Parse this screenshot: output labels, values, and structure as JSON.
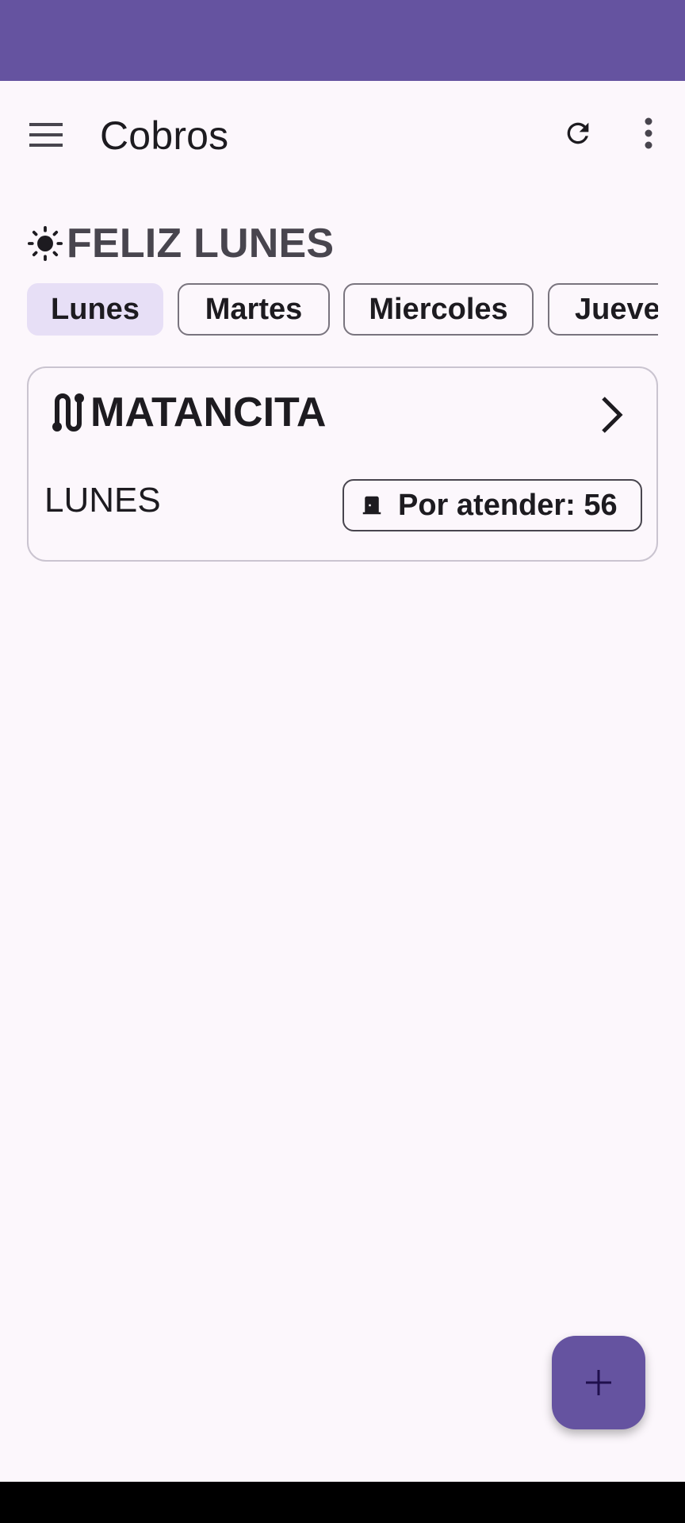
{
  "app": {
    "title": "Cobros"
  },
  "greeting": {
    "text": "FELIZ LUNES",
    "icon": "sun-icon"
  },
  "days": [
    {
      "label": "Lunes",
      "selected": true
    },
    {
      "label": "Martes",
      "selected": false
    },
    {
      "label": "Miercoles",
      "selected": false
    },
    {
      "label": "Jueves",
      "selected": false
    }
  ],
  "route_card": {
    "name": "MATANCITA",
    "route_icon": "route-icon",
    "day": "LUNES",
    "pending_label": "Por atender: 56",
    "pending_icon": "door-icon"
  },
  "icons": {
    "menu": "menu-icon",
    "refresh": "refresh-icon",
    "more": "more-vert-icon",
    "fab": "add-icon",
    "chevron": "chevron-right-icon"
  },
  "colors": {
    "primary": "#6553A0",
    "background": "#FCF7FC",
    "chip_selected": "#E7DFF6",
    "outline": "#79747E",
    "on_surface": "#1D1B20",
    "on_surface_variant": "#48454E"
  }
}
